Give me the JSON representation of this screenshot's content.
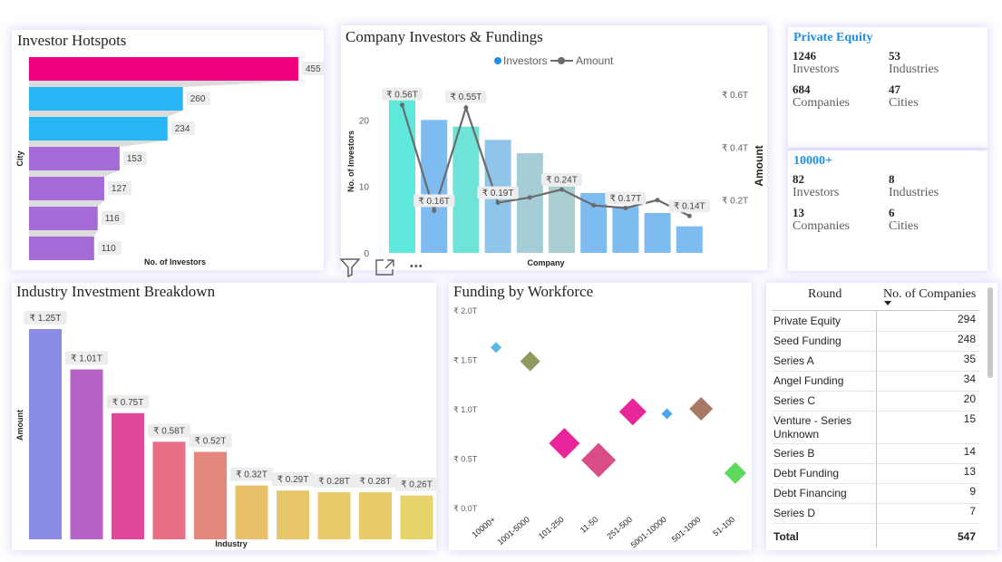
{
  "hotspots": {
    "title": "Investor Hotspots",
    "ylabel": "City",
    "xlabel": "No. of Investors",
    "colors": [
      "#f0007f",
      "#29b6f6",
      "#29b6f6",
      "#a46ad6",
      "#a46ad6",
      "#a46ad6",
      "#a46ad6"
    ]
  },
  "company": {
    "title": "Company Investors & Fundings",
    "legend_investors": "Investors",
    "legend_amount": "Amount",
    "ylabel_left": "No. of Investors",
    "ylabel_right": "Amount",
    "xlabel": "Company",
    "left_ticks": [
      "0",
      "10",
      "20"
    ],
    "right_ticks": [
      "₹ 0.2T",
      "₹ 0.4T",
      "₹ 0.6T"
    ],
    "bar_colors": [
      "#5ee8dc",
      "#7dbbf0",
      "#6ee4d8",
      "#8fc5e8",
      "#a4cdd8",
      "#a9cfd2",
      "#7dbbf0",
      "#7dbbf0",
      "#7dbbf0",
      "#7dbbf0"
    ],
    "labels": [
      "₹ 0.56T",
      "₹ 0.16T",
      "₹ 0.55T",
      "₹ 0.19T",
      "₹ 0.24T",
      "₹ 0.17T",
      "₹ 0.14T"
    ]
  },
  "toolbar": {
    "filter_icon": "filter-icon",
    "expand_icon": "focus-mode-icon",
    "more_icon": "more-options-icon",
    "more_label": "•••"
  },
  "private_equity": {
    "title": "Private Equity",
    "investors_value": "1246",
    "investors_label": "Investors",
    "industries_value": "53",
    "industries_label": "Industries",
    "companies_value": "684",
    "companies_label": "Companies",
    "cities_value": "47",
    "cities_label": "Cities"
  },
  "workforce_10000": {
    "title": "10000+",
    "investors_value": "82",
    "investors_label": "Investors",
    "industries_value": "8",
    "industries_label": "Industries",
    "companies_value": "13",
    "companies_label": "Companies",
    "cities_value": "6",
    "cities_label": "Cities"
  },
  "industry": {
    "title": "Industry Investment Breakdown",
    "ylabel": "Amount",
    "xlabel": "Industry",
    "colors": [
      "#8b8ce8",
      "#b562c9",
      "#e0479a",
      "#e96f86",
      "#e6877e",
      "#e8c06a",
      "#e8c66a",
      "#e8ca6a",
      "#e8cc6a",
      "#e8d26a"
    ]
  },
  "workforce": {
    "title": "Funding by Workforce",
    "y_ticks": [
      "₹ 0.0T",
      "₹ 0.5T",
      "₹ 1.0T",
      "₹ 1.5T",
      "₹ 2.0T"
    ]
  },
  "rounds_table": {
    "col_round": "Round",
    "col_companies": "No. of Companies",
    "rows": [
      {
        "round": "Private Equity",
        "count": "294"
      },
      {
        "round": "Seed Funding",
        "count": "248"
      },
      {
        "round": "Series A",
        "count": "35"
      },
      {
        "round": "Angel Funding",
        "count": "34"
      },
      {
        "round": "Series C",
        "count": "20"
      },
      {
        "round": "Venture - Series Unknown",
        "count": "15"
      },
      {
        "round": "Series B",
        "count": "14"
      },
      {
        "round": "Debt Funding",
        "count": "13"
      },
      {
        "round": "Debt Financing",
        "count": "9"
      },
      {
        "round": "Series D",
        "count": "7"
      }
    ],
    "total_label": "Total",
    "total_value": "547"
  },
  "chart_data": [
    {
      "type": "bar",
      "orientation": "horizontal",
      "title": "Investor Hotspots",
      "xlabel": "No. of Investors",
      "ylabel": "City",
      "values": [
        455,
        260,
        234,
        153,
        127,
        116,
        110
      ]
    },
    {
      "type": "bar+line",
      "title": "Company Investors & Fundings",
      "xlabel": "Company",
      "ylabel": "No. of Investors",
      "y2label": "Amount",
      "series": [
        {
          "name": "Investors",
          "type": "bar",
          "values": [
            24,
            20,
            19,
            17,
            15,
            10,
            9,
            7,
            6,
            4
          ]
        },
        {
          "name": "Amount",
          "type": "line",
          "unit": "₹ T",
          "values": [
            0.56,
            0.16,
            0.55,
            0.19,
            0.21,
            0.24,
            0.18,
            0.17,
            0.2,
            0.14
          ]
        }
      ],
      "ylim": [
        0,
        27
      ],
      "y2lim": [
        0,
        0.7
      ],
      "legend": "top"
    },
    {
      "type": "bar",
      "title": "Industry Investment Breakdown",
      "xlabel": "Industry",
      "ylabel": "Amount",
      "values": [
        1.25,
        1.01,
        0.75,
        0.58,
        0.52,
        0.32,
        0.29,
        0.28,
        0.28,
        0.26
      ],
      "value_labels": [
        "₹ 1.25T",
        "₹ 1.01T",
        "₹ 0.75T",
        "₹ 0.58T",
        "₹ 0.52T",
        "₹ 0.32T",
        "₹ 0.29T",
        "₹ 0.28T",
        "₹ 0.28T",
        "₹ 0.26T"
      ]
    },
    {
      "type": "scatter",
      "title": "Funding by Workforce",
      "categories": [
        "10000+",
        "1001-5000",
        "101-250",
        "11-50",
        "251-500",
        "5001-10000",
        "501-1000",
        "51-100"
      ],
      "points": [
        {
          "x": "10000+",
          "y": 1.62,
          "color": "#5bb8e6"
        },
        {
          "x": "1001-5000",
          "y": 1.48,
          "color": "#8f9a5e"
        },
        {
          "x": "101-250",
          "y": 0.65,
          "color": "#e8259a"
        },
        {
          "x": "11-50",
          "y": 0.48,
          "color": "#d94c85"
        },
        {
          "x": "251-500",
          "y": 0.97,
          "color": "#e8259a"
        },
        {
          "x": "5001-10000",
          "y": 0.95,
          "color": "#4aa6ee"
        },
        {
          "x": "501-1000",
          "y": 1.0,
          "color": "#a87a66"
        },
        {
          "x": "51-100",
          "y": 0.35,
          "color": "#5ed95e"
        }
      ],
      "ylim": [
        0,
        2.0
      ]
    }
  ]
}
